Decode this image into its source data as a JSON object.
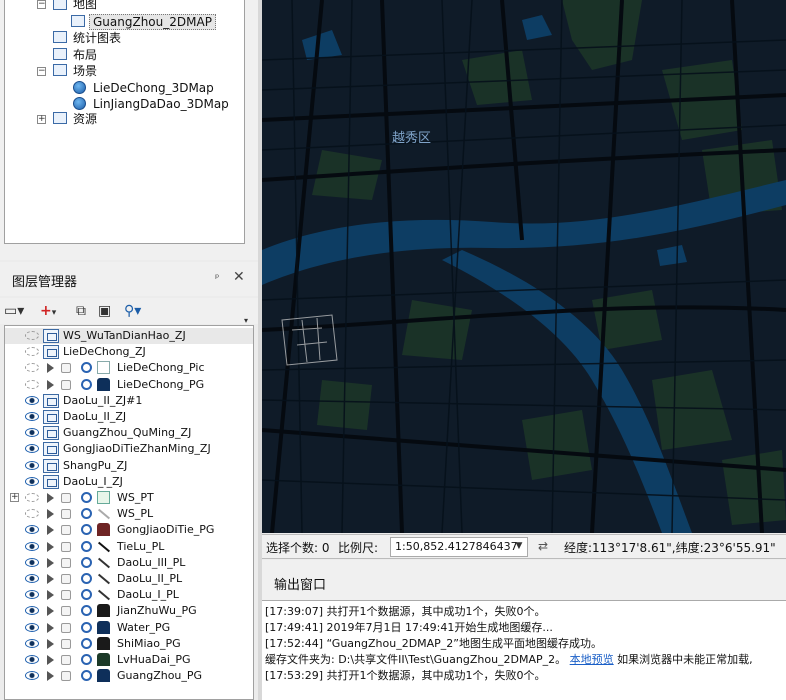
{
  "workspace": {
    "items": [
      {
        "label": "地图"
      },
      {
        "label": "GuangZhou_2DMAP"
      },
      {
        "label": "统计图表"
      },
      {
        "label": "布局"
      },
      {
        "label": "场景"
      },
      {
        "label": "LieDeChong_3DMap"
      },
      {
        "label": "LinJiangDaDao_3DMap"
      },
      {
        "label": "资源"
      }
    ]
  },
  "layer_manager": {
    "title": "图层管理器",
    "pin_glyph": "ᵖ",
    "close_glyph": "✕",
    "layers": [
      {
        "label": "WS_WuTanDianHao_ZJ",
        "visible": false
      },
      {
        "label": "LieDeChong_ZJ",
        "visible": false
      },
      {
        "label": "LieDeChong_Pic",
        "visible": false
      },
      {
        "label": "LieDeChong_PG",
        "visible": false
      },
      {
        "label": "DaoLu_II_ZJ#1",
        "visible": true
      },
      {
        "label": "DaoLu_II_ZJ",
        "visible": true
      },
      {
        "label": "GuangZhou_QuMing_ZJ",
        "visible": true
      },
      {
        "label": "GongJiaoDiTieZhanMing_ZJ",
        "visible": true
      },
      {
        "label": "ShangPu_ZJ",
        "visible": true
      },
      {
        "label": "DaoLu_I_ZJ",
        "visible": true
      },
      {
        "label": "WS_PT",
        "visible": false
      },
      {
        "label": "WS_PL",
        "visible": false
      },
      {
        "label": "GongJiaoDiTie_PG",
        "visible": true
      },
      {
        "label": "TieLu_PL",
        "visible": true
      },
      {
        "label": "DaoLu_III_PL",
        "visible": true
      },
      {
        "label": "DaoLu_II_PL",
        "visible": true
      },
      {
        "label": "DaoLu_I_PL",
        "visible": true
      },
      {
        "label": "JianZhuWu_PG",
        "visible": true
      },
      {
        "label": "Water_PG",
        "visible": true
      },
      {
        "label": "ShiMiao_PG",
        "visible": true
      },
      {
        "label": "LvHuaDai_PG",
        "visible": true
      },
      {
        "label": "GuangZhou_PG",
        "visible": true
      }
    ]
  },
  "map": {
    "district_label": "越秀区",
    "water_color": "#0d3d63",
    "land_color": "#0f1b28",
    "green_color": "#1f3a2a"
  },
  "statusbar": {
    "selected_label": "选择个数: 0",
    "scale_label": "比例尺:",
    "scale_value": "1:50,852.4127846437",
    "coords": "经度:113°17'8.61\",纬度:23°6'55.91\""
  },
  "output": {
    "title": "输出窗口",
    "lines": [
      "[17:39:07] 共打开1个数据源，其中成功1个，失败0个。",
      "[17:49:41] 2019年7月1日 17:49:41开始生成地图缓存...",
      "[17:52:44] “GuangZhou_2DMAP_2”地图生成平面地图缓存成功。",
      "缓存文件夹为: D:\\共享文件II\\Test\\GuangZhou_2DMAP_2。",
      "本地预览",
      "如果浏览器中未能正常加载,",
      "[17:53:29] 共打开1个数据源，其中成功1个，失败0个。"
    ]
  }
}
